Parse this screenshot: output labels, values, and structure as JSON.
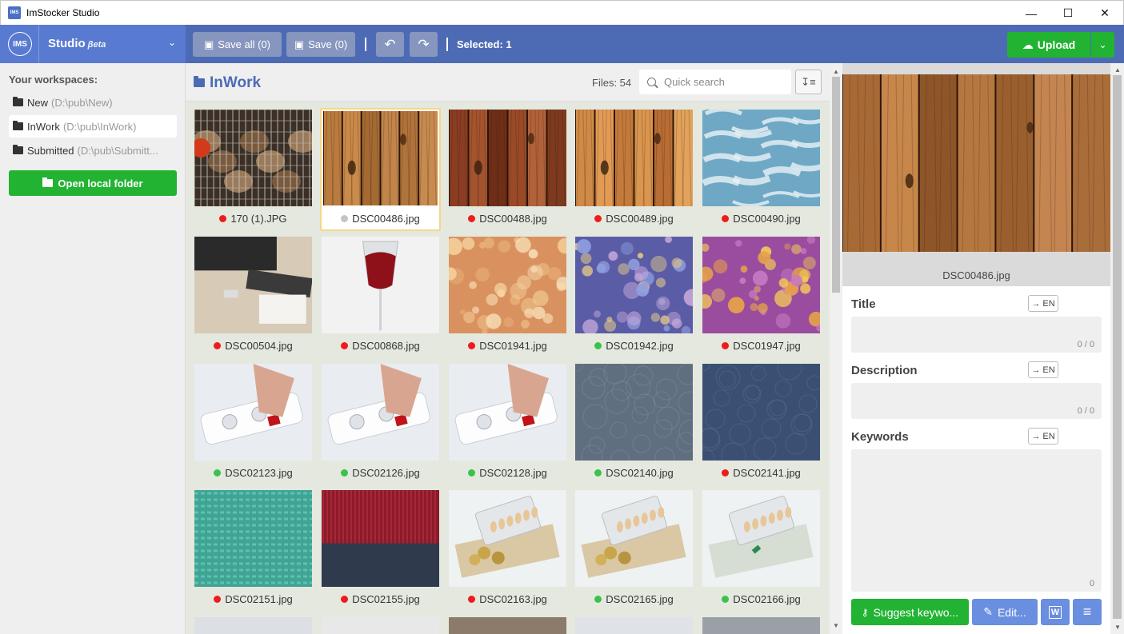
{
  "window": {
    "title": "ImStocker Studio",
    "controls": [
      "—",
      "☐",
      "✕"
    ]
  },
  "brand": {
    "logo": "IMS",
    "name": "Studio",
    "beta": "βeta",
    "chevron": "⌄"
  },
  "toolbar": {
    "save_all": "Save all (0)",
    "save": "Save (0)",
    "undo": "↶",
    "redo": "↷",
    "selected": "Selected: 1",
    "upload": "Upload",
    "upload_dropdown": "⌄"
  },
  "sidebar": {
    "header": "Your workspaces:",
    "items": [
      {
        "label": "New",
        "path": "(D:\\pub\\New)",
        "active": false
      },
      {
        "label": "InWork",
        "path": "(D:\\pub\\InWork)",
        "active": true
      },
      {
        "label": "Submitted",
        "path": "(D:\\pub\\Submitt...",
        "active": false
      }
    ],
    "open_folder": "Open local folder"
  },
  "main": {
    "title": "InWork",
    "files_count": "Files: 54",
    "search_placeholder": "Quick search",
    "sort_icon": "↧≡"
  },
  "status_colors": {
    "red": "#ee1c1c",
    "green": "#3cc24a",
    "gray": "#c4c4c4"
  },
  "thumbnails": [
    {
      "name": "170 (1).JPG",
      "status": "red",
      "img": "grill"
    },
    {
      "name": "DSC00486.jpg",
      "status": "gray",
      "img": "wood-light",
      "selected": true
    },
    {
      "name": "DSC00488.jpg",
      "status": "red",
      "img": "wood-red"
    },
    {
      "name": "DSC00489.jpg",
      "status": "red",
      "img": "wood-orange"
    },
    {
      "name": "DSC00490.jpg",
      "status": "red",
      "img": "paint-blue"
    },
    {
      "name": "DSC00504.jpg",
      "status": "red",
      "img": "desk"
    },
    {
      "name": "DSC00868.jpg",
      "status": "red",
      "img": "wine"
    },
    {
      "name": "DSC01941.jpg",
      "status": "red",
      "img": "bokeh-orange"
    },
    {
      "name": "DSC01942.jpg",
      "status": "green",
      "img": "bokeh-purple"
    },
    {
      "name": "DSC01947.jpg",
      "status": "red",
      "img": "bokeh-violet"
    },
    {
      "name": "DSC02123.jpg",
      "status": "green",
      "img": "powerstrip"
    },
    {
      "name": "DSC02126.jpg",
      "status": "green",
      "img": "powerstrip"
    },
    {
      "name": "DSC02128.jpg",
      "status": "green",
      "img": "powerstrip"
    },
    {
      "name": "DSC02140.jpg",
      "status": "green",
      "img": "leather-gray"
    },
    {
      "name": "DSC02141.jpg",
      "status": "red",
      "img": "leather-blue"
    },
    {
      "name": "DSC02151.jpg",
      "status": "red",
      "img": "knit-teal"
    },
    {
      "name": "DSC02155.jpg",
      "status": "red",
      "img": "knit-red"
    },
    {
      "name": "DSC02163.jpg",
      "status": "red",
      "img": "money-pills"
    },
    {
      "name": "DSC02165.jpg",
      "status": "green",
      "img": "money-pills"
    },
    {
      "name": "DSC02166.jpg",
      "status": "green",
      "img": "dollar-pills"
    }
  ],
  "panel": {
    "preview_name": "DSC00486.jpg",
    "title_label": "Title",
    "title_count": "0 / 0",
    "description_label": "Description",
    "description_count": "0 / 0",
    "keywords_label": "Keywords",
    "keywords_count": "0",
    "lang_button": "→ EN",
    "suggest": "Suggest keywo...",
    "edit": "Edit...",
    "word_icon": "W",
    "menu_icon": "≡"
  }
}
